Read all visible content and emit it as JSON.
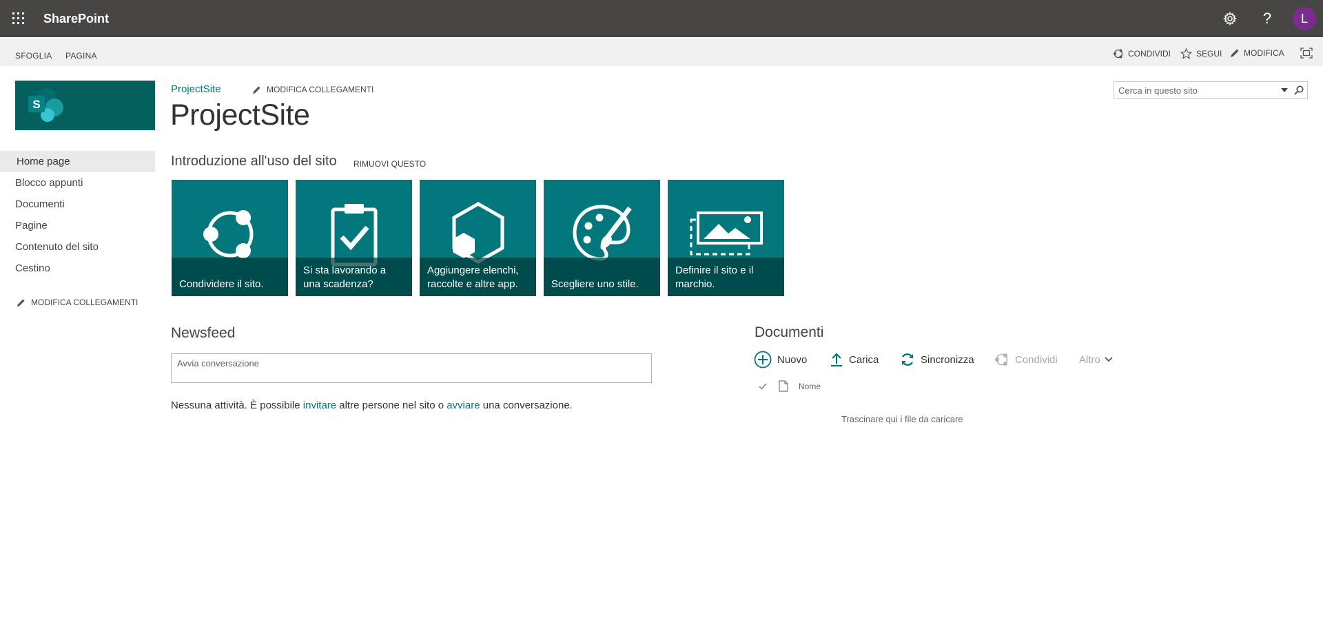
{
  "suite": {
    "app_name": "SharePoint",
    "avatar_initial": "L",
    "help_glyph": "?",
    "icons": [
      "app-launcher-icon",
      "gear-icon",
      "help-icon"
    ]
  },
  "ribbon": {
    "tabs": [
      "SFOGLIA",
      "PAGINA"
    ],
    "share_label": "CONDIVIDI",
    "follow_label": "SEGUI",
    "edit_label": "MODIFICA"
  },
  "header": {
    "breadcrumb": "ProjectSite",
    "edit_links_label": "MODIFICA COLLEGAMENTI",
    "site_title": "ProjectSite",
    "search_placeholder": "Cerca in questo sito"
  },
  "leftnav": {
    "items": [
      {
        "label": "Home page",
        "active": true
      },
      {
        "label": "Blocco appunti"
      },
      {
        "label": "Documenti"
      },
      {
        "label": "Pagine"
      },
      {
        "label": "Contenuto del sito"
      },
      {
        "label": "Cestino"
      }
    ],
    "edit_links_label": "MODIFICA COLLEGAMENTI"
  },
  "getting_started": {
    "title": "Introduzione all'uso del sito",
    "remove_label": "RIMUOVI QUESTO",
    "tiles": [
      {
        "caption": "Condividere il sito.",
        "icon": "share-circle-icon"
      },
      {
        "caption": "Si sta lavorando a una scadenza?",
        "icon": "clipboard-check-icon"
      },
      {
        "caption": "Aggiungere elenchi, raccolte e altre app.",
        "icon": "hexagon-apps-icon"
      },
      {
        "caption": "Scegliere uno stile.",
        "icon": "palette-icon"
      },
      {
        "caption": "Definire il sito e il marchio.",
        "icon": "image-frame-icon"
      }
    ],
    "tile_color": "#03787c"
  },
  "newsfeed": {
    "title": "Newsfeed",
    "placeholder": "Avvia conversazione",
    "activity_prefix": "Nessuna attività. È possibile ",
    "invite_link": "invitare",
    "activity_middle": " altre persone nel sito o ",
    "start_link": "avviare",
    "activity_suffix": " una conversazione."
  },
  "documents": {
    "title": "Documenti",
    "new_label": "Nuovo",
    "upload_label": "Carica",
    "sync_label": "Sincronizza",
    "share_label": "Condividi",
    "more_label": "Altro",
    "column_name": "Nome",
    "drop_hint": "Trascinare qui i file da caricare"
  },
  "colors": {
    "suite_bar": "#484644",
    "accent": "#03787c",
    "logo_bg": "#03605d",
    "avatar": "#7b2d8e"
  }
}
